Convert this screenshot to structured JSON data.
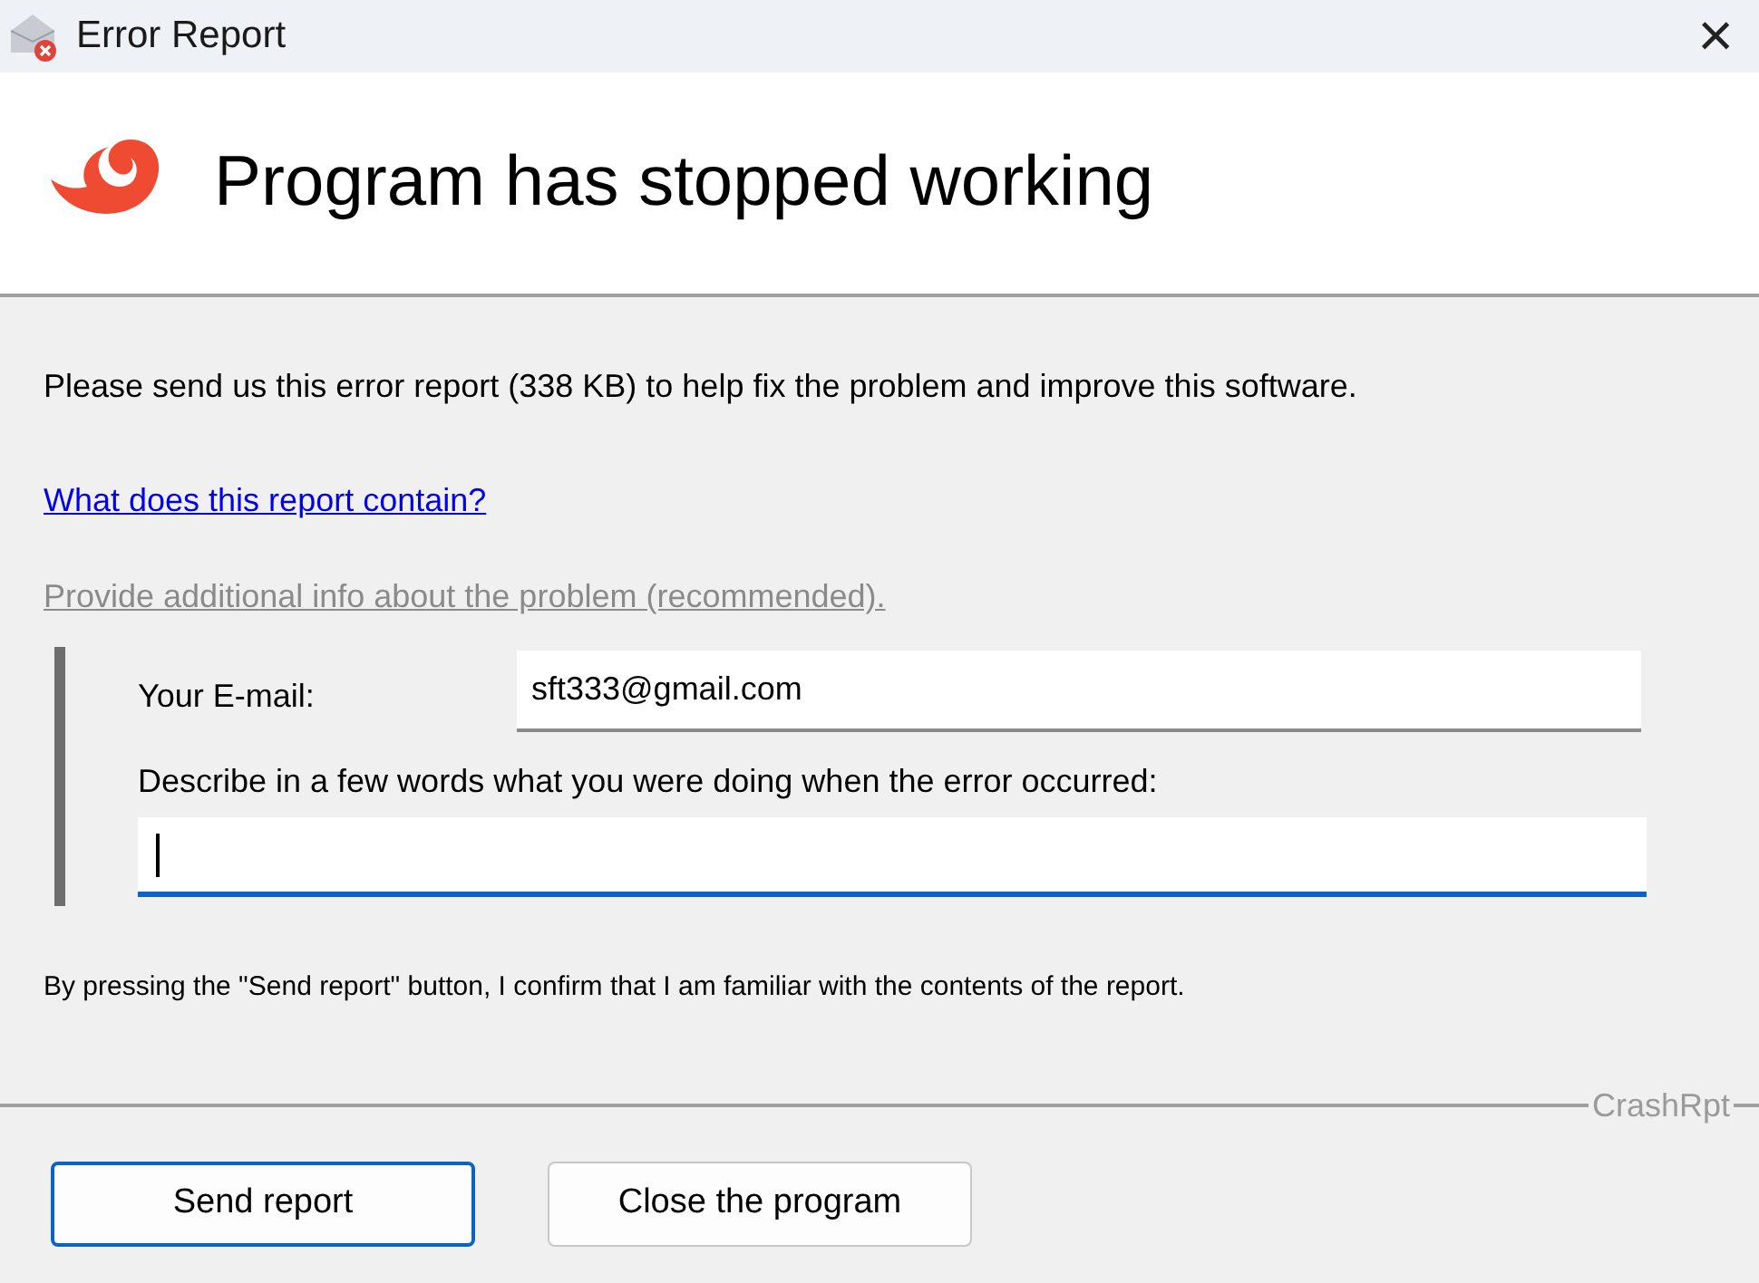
{
  "window": {
    "title": "Error Report",
    "close_glyph": "×"
  },
  "header": {
    "title": "Program has stopped working"
  },
  "intro": "Please send us this error report (338 KB) to help fix the problem and improve this software.",
  "links": [
    {
      "label": "What does this report contain?",
      "disabled": false
    },
    {
      "label": "Provide additional info about the problem (recommended).",
      "disabled": true
    }
  ],
  "form": {
    "email_label": "Your E-mail:",
    "email_value": "sft333@gmail.com",
    "description_label": "Describe in a few words what you were doing when the error occurred:",
    "description_focused": true
  },
  "confirm": "By pressing the \"Send report\" button, I confirm that I am familiar with the contents of the report.",
  "separator_label": "CrashRpt",
  "buttons": [
    {
      "label": "Send report",
      "default": true
    },
    {
      "label": "Close the program",
      "default": false
    }
  ]
}
